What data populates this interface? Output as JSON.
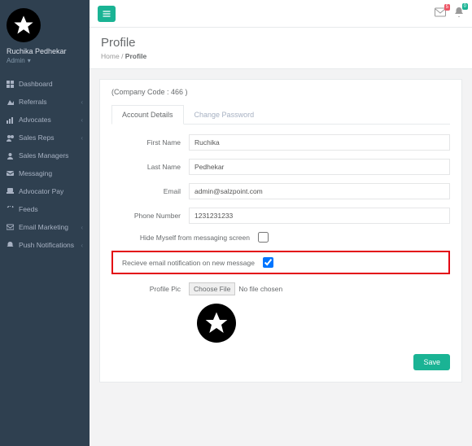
{
  "user": {
    "name": "Ruchika Pedhekar",
    "role": "Admin"
  },
  "nav": {
    "items": [
      {
        "label": "Dashboard",
        "expandable": false
      },
      {
        "label": "Referrals",
        "expandable": true
      },
      {
        "label": "Advocates",
        "expandable": true
      },
      {
        "label": "Sales Reps",
        "expandable": true
      },
      {
        "label": "Sales Managers",
        "expandable": false
      },
      {
        "label": "Messaging",
        "expandable": false
      },
      {
        "label": "Advocator Pay",
        "expandable": false
      },
      {
        "label": "Feeds",
        "expandable": false
      },
      {
        "label": "Email Marketing",
        "expandable": true
      },
      {
        "label": "Push Notifications",
        "expandable": true
      }
    ]
  },
  "topbar": {
    "mail_badge": "5",
    "bell_badge": "0"
  },
  "page": {
    "title": "Profile",
    "crumb_home": "Home",
    "crumb_current": "Profile"
  },
  "company_code": "(Company Code : 466 )",
  "tabs": {
    "t0": "Account Details",
    "t1": "Change Password"
  },
  "form": {
    "first_name_label": "First Name",
    "first_name_value": "Ruchika",
    "last_name_label": "Last Name",
    "last_name_value": "Pedhekar",
    "email_label": "Email",
    "email_value": "admin@salzpoint.com",
    "phone_label": "Phone Number",
    "phone_value": "1231231233",
    "hide_label": "Hide Myself from messaging screen",
    "notif_label": "Recieve email notification on new message",
    "pic_label": "Profile Pic",
    "choose_file": "Choose File",
    "no_file": "No file chosen",
    "save": "Save"
  }
}
